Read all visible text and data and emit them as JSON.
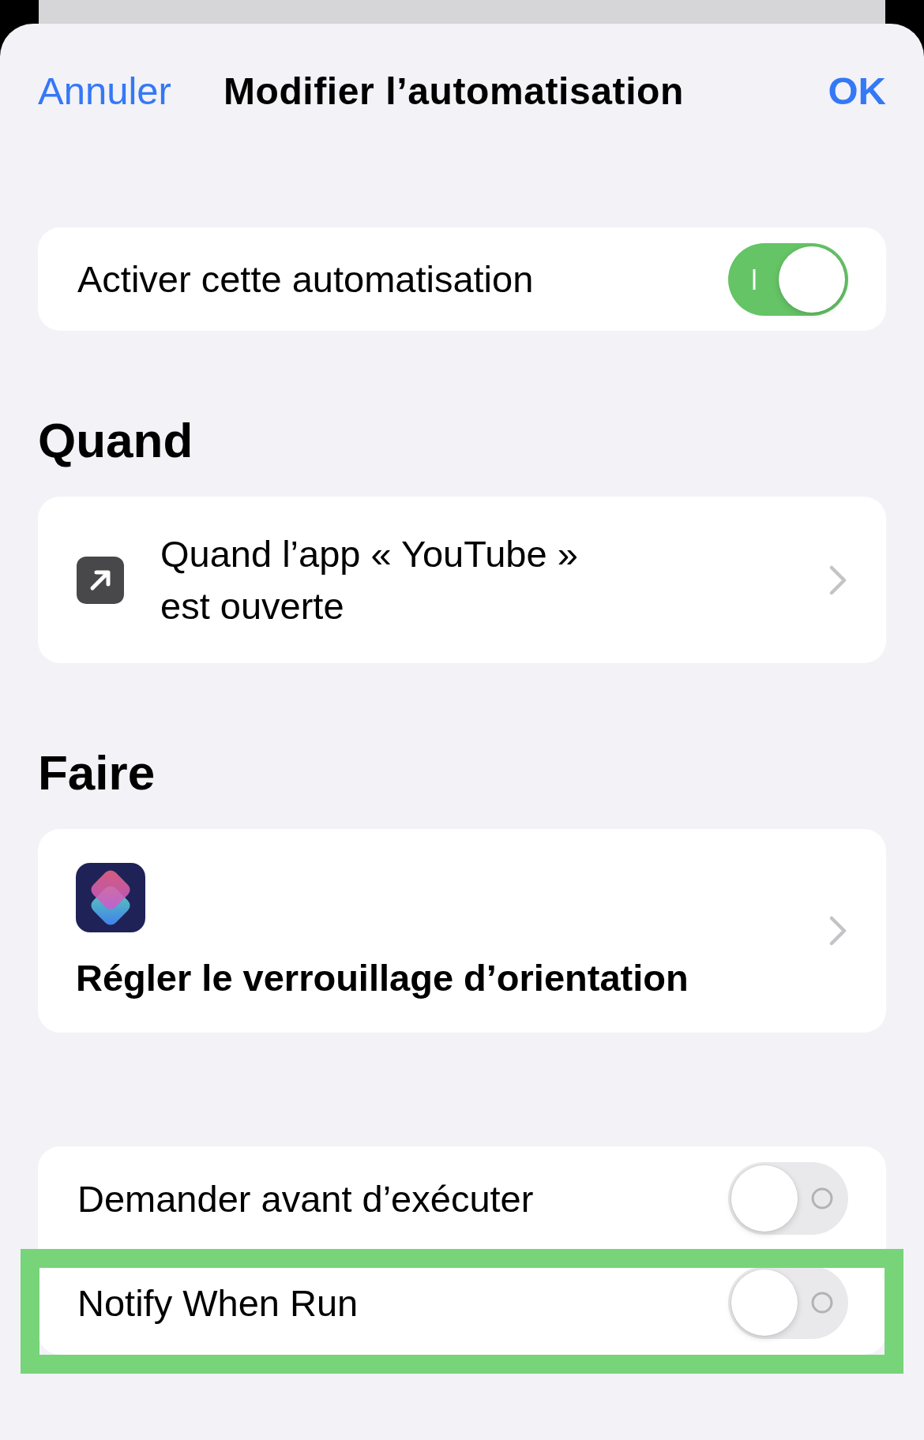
{
  "header": {
    "cancel": "Annuler",
    "title": "Modifier l’automatisation",
    "done": "OK"
  },
  "enable_row": {
    "label": "Activer cette automatisation",
    "on": true
  },
  "when": {
    "heading": "Quand",
    "trigger": "Quand l’app « YouTube » est ouverte"
  },
  "do": {
    "heading": "Faire",
    "action": "Régler le verrouillage d’orientation"
  },
  "options": [
    {
      "label": "Demander avant d’exécuter",
      "on": false,
      "highlighted": false
    },
    {
      "label": "Notify When Run",
      "on": false,
      "highlighted": true
    }
  ]
}
